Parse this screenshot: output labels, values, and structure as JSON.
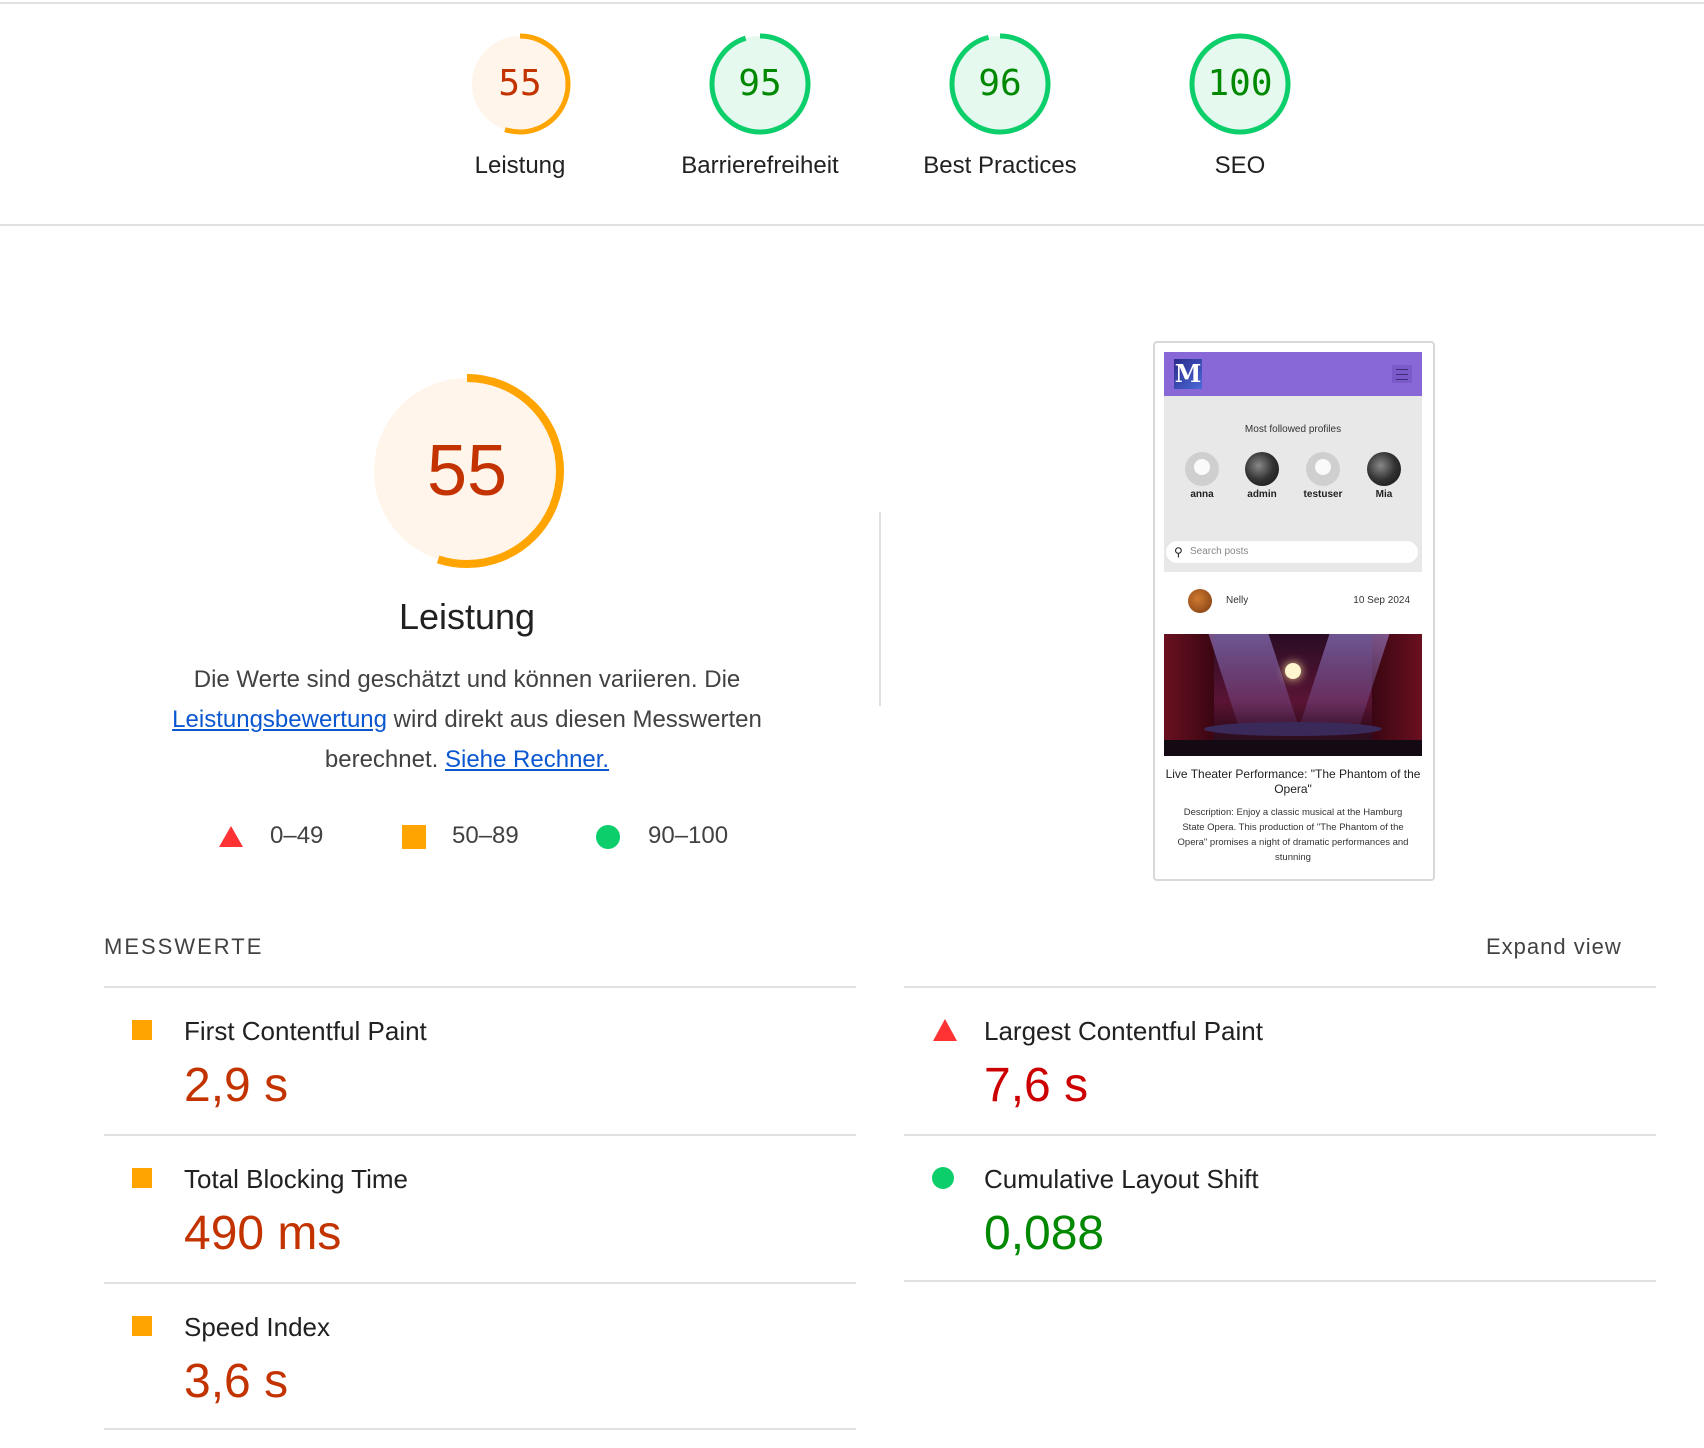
{
  "scores": [
    {
      "value": "55",
      "label": "Leistung",
      "rating": "average",
      "fraction": 0.55
    },
    {
      "value": "95",
      "label": "Barrierefreiheit",
      "rating": "pass",
      "fraction": 0.95
    },
    {
      "value": "96",
      "label": "Best Practices",
      "rating": "pass",
      "fraction": 0.96
    },
    {
      "value": "100",
      "label": "SEO",
      "rating": "pass",
      "fraction": 1.0
    }
  ],
  "performance": {
    "score": "55",
    "fraction": 0.55,
    "title": "Leistung",
    "desc_part1": "Die Werte sind geschätzt und können variieren. Die",
    "desc_link1": "Leistungsbewertung",
    "desc_part2": "wird direkt aus diesen Messwerten berechnet.",
    "desc_link2": "Siehe Rechner."
  },
  "legend": [
    {
      "range": "0–49",
      "shape": "triangle",
      "color": "#ff3333"
    },
    {
      "range": "50–89",
      "shape": "square",
      "color": "#ffa400"
    },
    {
      "range": "90–100",
      "shape": "circle",
      "color": "#0cce6b"
    }
  ],
  "screenshot": {
    "logo": "M",
    "most_followed": "Most followed profiles",
    "profiles": [
      "anna",
      "admin",
      "testuser",
      "Mia"
    ],
    "search_placeholder": "Search posts",
    "post_author": "Nelly",
    "post_date": "10 Sep 2024",
    "post_title": "Live Theater Performance: \"The Phantom of the Opera\"",
    "post_desc": "Description: Enjoy a classic musical at the Hamburg State Opera. This production of \"The Phantom of the Opera\" promises a night of dramatic performances and stunning"
  },
  "metrics": {
    "section_title": "MESSWERTE",
    "expand_label": "Expand view",
    "items": [
      {
        "name": "First Contentful Paint",
        "value": "2,9 s",
        "rating": "average",
        "color": "#c33300"
      },
      {
        "name": "Largest Contentful Paint",
        "value": "7,6 s",
        "rating": "fail",
        "color": "#cc0000"
      },
      {
        "name": "Total Blocking Time",
        "value": "490 ms",
        "rating": "average",
        "color": "#c33300"
      },
      {
        "name": "Cumulative Layout Shift",
        "value": "0,088",
        "rating": "pass",
        "color": "#008800"
      },
      {
        "name": "Speed Index",
        "value": "3,6 s",
        "rating": "average",
        "color": "#c33300"
      }
    ]
  },
  "colors": {
    "average_ring": "#ffa400",
    "average_fill": "#fff5ea",
    "average_text": "#c33300",
    "pass_ring": "#0cce6b",
    "pass_fill": "#e6f9ef",
    "pass_text": "#008800"
  }
}
